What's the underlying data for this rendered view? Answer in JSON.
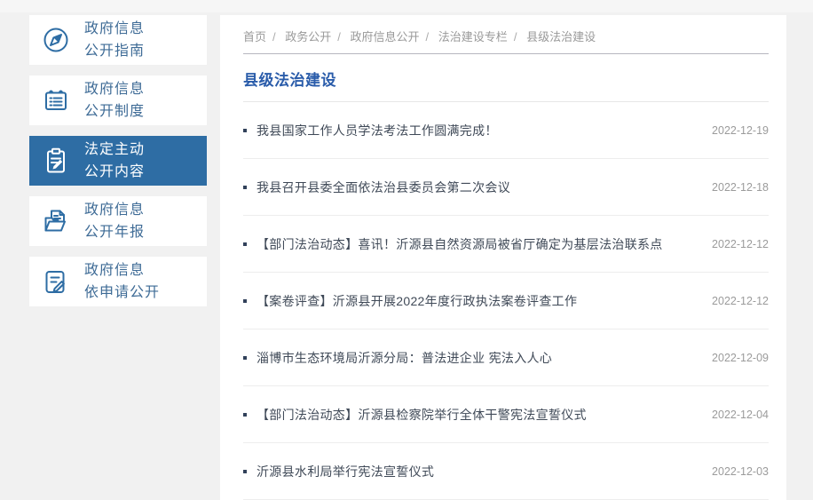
{
  "page": {
    "background": "#f1f1f1",
    "accent_blue": "#2e6da4",
    "title_blue": "#2a5caa",
    "date_gray": "#9b9b9b"
  },
  "sidebar": {
    "items": [
      {
        "label": "政府信息公开指南",
        "lines": [
          "政府信息",
          "公开指南"
        ],
        "icon": "compass-icon",
        "active": false,
        "expand_icon": ""
      },
      {
        "label": "政府信息公开制度",
        "lines": [
          "政府信息",
          "公开制度"
        ],
        "icon": "ledger-icon",
        "active": false,
        "expand_icon": ""
      },
      {
        "label": "法定主动公开内容",
        "lines": [
          "法定主动",
          "公开内容"
        ],
        "icon": "clipboard-pencil-icon",
        "active": true,
        "expand_icon": "minus-icon"
      },
      {
        "label": "政府信息公开年报",
        "lines": [
          "政府信息",
          "公开年报"
        ],
        "icon": "folder-document-icon",
        "active": false,
        "expand_icon": "plus-icon"
      },
      {
        "label": "政府信息依申请公开",
        "lines": [
          "政府信息",
          "依申请公开"
        ],
        "icon": "document-pencil-icon",
        "active": false,
        "expand_icon": ""
      }
    ]
  },
  "breadcrumb": {
    "separator": "/",
    "items": [
      "首页",
      "政务公开",
      "政府信息公开",
      "法治建设专栏",
      "县级法治建设"
    ]
  },
  "main": {
    "title": "县级法治建设",
    "articles": [
      {
        "title": "我县国家工作人员学法考法工作圆满完成！",
        "date": "2022-12-19"
      },
      {
        "title": "我县召开县委全面依法治县委员会第二次会议",
        "date": "2022-12-18"
      },
      {
        "title": "【部门法治动态】喜讯！沂源县自然资源局被省厅确定为基层法治联系点",
        "date": "2022-12-12"
      },
      {
        "title": "【案卷评查】沂源县开展2022年度行政执法案卷评查工作",
        "date": "2022-12-12"
      },
      {
        "title": "淄博市生态环境局沂源分局：普法进企业 宪法入人心",
        "date": "2022-12-09"
      },
      {
        "title": "【部门法治动态】沂源县检察院举行全体干警宪法宣誓仪式",
        "date": "2022-12-04"
      },
      {
        "title": "沂源县水利局举行宪法宣誓仪式",
        "date": "2022-12-03"
      }
    ]
  }
}
